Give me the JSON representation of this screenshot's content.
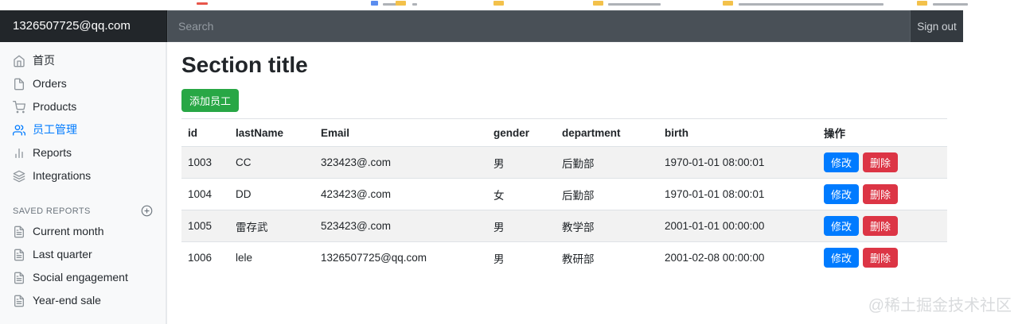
{
  "navbar": {
    "brand": "1326507725@qq.com",
    "search_placeholder": "Search",
    "sign_out_label": "Sign out"
  },
  "sidebar": {
    "items": [
      {
        "label": "首页",
        "icon": "home-icon",
        "active": false
      },
      {
        "label": "Orders",
        "icon": "file-icon",
        "active": false
      },
      {
        "label": "Products",
        "icon": "shopping-cart-icon",
        "active": false
      },
      {
        "label": "员工管理",
        "icon": "users-icon",
        "active": true
      },
      {
        "label": "Reports",
        "icon": "bar-chart-icon",
        "active": false
      },
      {
        "label": "Integrations",
        "icon": "layers-icon",
        "active": false
      }
    ],
    "saved_reports": {
      "title": "SAVED REPORTS",
      "items": [
        {
          "label": "Current month",
          "icon": "file-text-icon"
        },
        {
          "label": "Last quarter",
          "icon": "file-text-icon"
        },
        {
          "label": "Social engagement",
          "icon": "file-text-icon"
        },
        {
          "label": "Year-end sale",
          "icon": "file-text-icon"
        }
      ]
    }
  },
  "main": {
    "title": "Section title",
    "add_button_label": "添加员工",
    "table": {
      "headers": [
        "id",
        "lastName",
        "Email",
        "gender",
        "department",
        "birth",
        "操作"
      ],
      "rows": [
        {
          "id": "1003",
          "lastName": "CC",
          "email": "323423@.com",
          "gender": "男",
          "department": "后勤部",
          "birth": "1970-01-01 08:00:01"
        },
        {
          "id": "1004",
          "lastName": "DD",
          "email": "423423@.com",
          "gender": "女",
          "department": "后勤部",
          "birth": "1970-01-01 08:00:01"
        },
        {
          "id": "1005",
          "lastName": "雷存武",
          "email": "523423@.com",
          "gender": "男",
          "department": "教学部",
          "birth": "2001-01-01 00:00:00"
        },
        {
          "id": "1006",
          "lastName": "lele",
          "email": "1326507725@qq.com",
          "gender": "男",
          "department": "教研部",
          "birth": "2001-02-08 00:00:00"
        }
      ],
      "actions": {
        "edit": "修改",
        "delete": "删除"
      }
    }
  },
  "watermark": "@稀土掘金技术社区",
  "colors": {
    "primary": "#007bff",
    "success": "#28a745",
    "danger": "#dc3545",
    "navbar_bg": "#343a40",
    "brand_bg": "#22262a",
    "search_bg": "#495057",
    "sidebar_bg": "#f8f9fa",
    "stripe": "#f2f2f2",
    "border": "#dee2e6"
  }
}
